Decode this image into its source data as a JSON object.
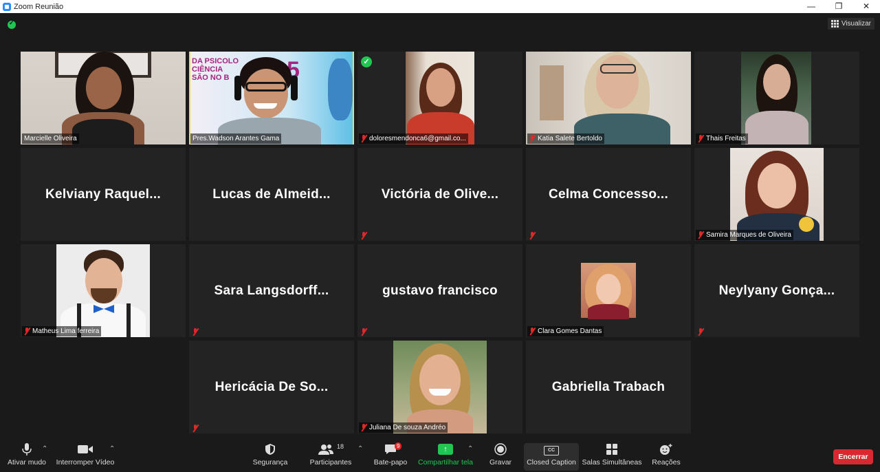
{
  "window": {
    "title": "Zoom Reunião",
    "minimize": "—",
    "maximize": "❐",
    "close": "✕"
  },
  "topbar": {
    "view_label": "Visualizar"
  },
  "tiles": [
    {
      "name": "Marcielle Oliveira",
      "muted": false
    },
    {
      "name": "Pres.Wadson Arantes Gama",
      "muted": false,
      "active": true,
      "banner": "DA PSICOLO\nCIÊNCIA\nSÃO NO B"
    },
    {
      "name": "doloresmendonca6@gmail.co...",
      "muted": true
    },
    {
      "name": "Katia Salete Bertoldo",
      "muted": true
    },
    {
      "name": "Thais Freitas",
      "muted": true
    },
    {
      "display": "Kelviany  Raquel...",
      "muted": false
    },
    {
      "display": "Lucas  de  Almeid...",
      "muted": false
    },
    {
      "display": "Victória  de  Olive...",
      "muted": true
    },
    {
      "display": "Celma  Concesso...",
      "muted": true
    },
    {
      "name": "Samira Marques de Oliveira",
      "muted": true
    },
    {
      "name": "Matheus Lima ferreira",
      "muted": true
    },
    {
      "display": "Sara  Langsdorff...",
      "muted": true
    },
    {
      "display": "gustavo francisco",
      "muted": true
    },
    {
      "name": "Clara Gomes Dantas",
      "muted": true
    },
    {
      "display": "Neylyany  Gonça...",
      "muted": true
    },
    {
      "display": "Hericácia  De  So...",
      "muted": true
    },
    {
      "name": "Juliana De souza Andréo",
      "muted": true
    },
    {
      "display": "Gabriella Trabach",
      "muted": false
    }
  ],
  "toolbar": {
    "mute": "Ativar mudo",
    "video": "Interromper Vídeo",
    "security": "Segurança",
    "participants": "Participantes",
    "participants_count": "18",
    "chat": "Bate-papo",
    "chat_badge": "9",
    "share": "Compartilhar tela",
    "record": "Gravar",
    "cc": "Closed Caption",
    "cc_icon": "CC",
    "breakout": "Salas Simultâneas",
    "reactions": "Reações",
    "end": "Encerrar"
  },
  "colors": {
    "accent_green": "#23c552",
    "end_red": "#d7292f",
    "active_border": "#e5e05a",
    "mute_red": "#e02828"
  }
}
